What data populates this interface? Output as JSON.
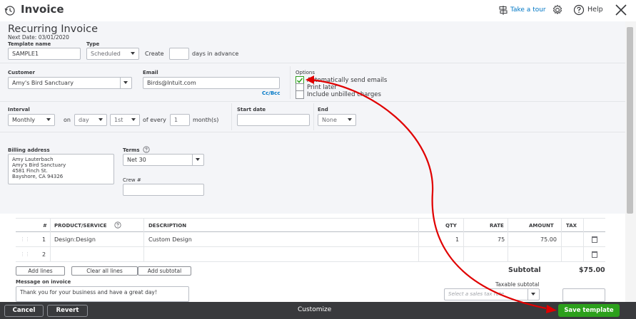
{
  "header": {
    "title": "Invoice",
    "take_tour": "Take a tour",
    "help": "Help"
  },
  "recurring": {
    "title": "Recurring Invoice",
    "next_date": "Next Date: 03/01/2020",
    "template_name_label": "Template name",
    "template_name_value": "SAMPLE1",
    "type_label": "Type",
    "type_value": "Scheduled",
    "create_label": "Create",
    "create_value": "",
    "days_advance": "days in advance"
  },
  "customer": {
    "label": "Customer",
    "value": "Amy's Bird Sanctuary",
    "email_label": "Email",
    "email_value": "Birds@Intuit.com",
    "cc_bcc": "Cc/Bcc"
  },
  "options": {
    "label": "Options",
    "items": [
      {
        "label": "Automatically send emails",
        "checked": true
      },
      {
        "label": "Print later",
        "checked": false
      },
      {
        "label": "Include unbilled charges",
        "checked": false
      }
    ]
  },
  "interval": {
    "label": "Interval",
    "frequency": "Monthly",
    "on": "on",
    "day": "day",
    "ordinal": "1st",
    "of_every": "of every",
    "every_value": "1",
    "months": "month(s)",
    "start_label": "Start date",
    "start_value": "",
    "end_label": "End",
    "end_value": "None"
  },
  "billing": {
    "label": "Billing address",
    "lines": [
      "Amy Lauterbach",
      "Amy's Bird Sanctuary",
      "4581 Finch St.",
      "Bayshore, CA  94326"
    ],
    "terms_label": "Terms",
    "terms_value": "Net 30",
    "crew_label": "Crew #",
    "crew_value": ""
  },
  "table": {
    "headers": {
      "num": "#",
      "product": "PRODUCT/SERVICE",
      "description": "DESCRIPTION",
      "qty": "QTY",
      "rate": "RATE",
      "amount": "AMOUNT",
      "tax": "TAX"
    },
    "rows": [
      {
        "num": "1",
        "product": "Design:Design",
        "description": "Custom Design",
        "qty": "1",
        "rate": "75",
        "amount": "75.00"
      },
      {
        "num": "2",
        "product": "",
        "description": "",
        "qty": "",
        "rate": "",
        "amount": ""
      }
    ]
  },
  "actions": {
    "add_lines": "Add lines",
    "clear_lines": "Clear all lines",
    "add_subtotal": "Add subtotal"
  },
  "totals": {
    "subtotal_label": "Subtotal",
    "subtotal_value": "$75.00",
    "taxable_label": "Taxable subtotal",
    "tax_placeholder": "Select a sales tax rate"
  },
  "message": {
    "label": "Message on invoice",
    "value": "Thank you for your business and have a great day!"
  },
  "footer": {
    "cancel": "Cancel",
    "revert": "Revert",
    "customize": "Customize",
    "save": "Save template"
  },
  "colors": {
    "accent_green": "#2ca01c",
    "link_blue": "#0077c5",
    "annotation_red": "#e00000",
    "footer_bg": "#393a3d"
  }
}
